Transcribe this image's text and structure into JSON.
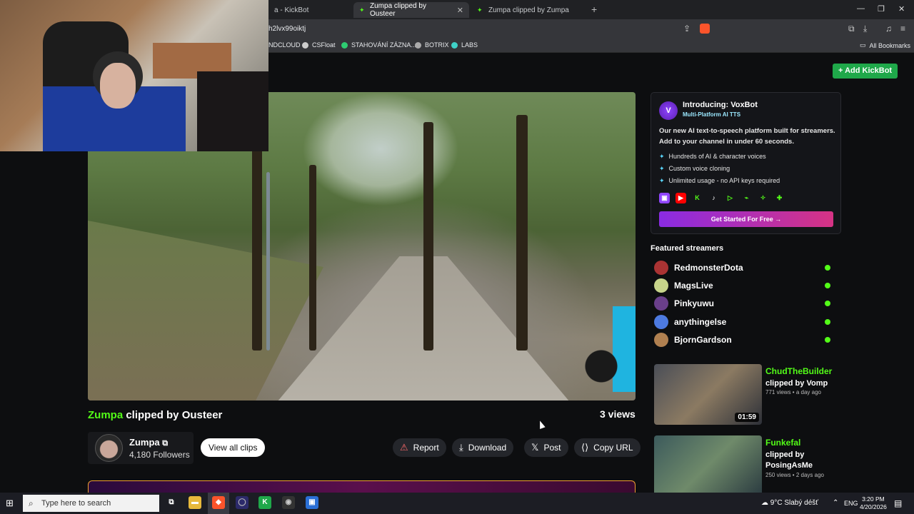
{
  "browser": {
    "tabs": [
      {
        "label": "a - KickBot",
        "active": false
      },
      {
        "label": "Zumpa clipped by Ousteer",
        "active": true
      },
      {
        "label": "Zumpa clipped by Zumpa",
        "active": false
      }
    ],
    "url": "h2lvx99oiktj",
    "bookmarks": [
      "NDCLOUD",
      "CSFloat",
      "STAHOVÁNÍ ZÁZNA...",
      "BOTRIX",
      "LABS"
    ],
    "all_bookmarks": "All Bookmarks"
  },
  "header": {
    "add_kickbot": "+ Add KickBot"
  },
  "clip": {
    "channel_name": "Zumpa",
    "title_rest": "clipped by Ousteer",
    "views": "3 views",
    "streamer": "Zumpa",
    "followers": "4,180 Followers",
    "view_all": "View all clips",
    "actions": {
      "report": "Report",
      "download": "Download",
      "post": "Post",
      "copy_url": "Copy URL"
    }
  },
  "promo": {
    "title": "Introducing: VoxBot",
    "subtitle": "Multi-Platform AI TTS",
    "description": "Our new AI text-to-speech platform built for streamers. Add to your channel in under 60 seconds.",
    "features": [
      "Hundreds of AI & character voices",
      "Custom voice cloning",
      "Unlimited usage - no API keys required"
    ],
    "cta": "Get Started For Free →"
  },
  "featured": {
    "title": "Featured streamers",
    "streamers": [
      "RedmonsterDota",
      "MagsLive",
      "Pinkyuwu",
      "anythingelse",
      "BjornGardson"
    ]
  },
  "related": [
    {
      "channel": "ChudTheBuilder",
      "by": "clipped by Vomp",
      "meta": "771 views • a day ago",
      "duration": "01:59"
    },
    {
      "channel": "Funkefal",
      "by": "clipped by PosingAsMe",
      "meta": "250 views • 2 days ago",
      "duration": ""
    }
  ],
  "taskbar": {
    "search_placeholder": "Type here to search",
    "weather": "9°C  Slabý déšť",
    "lang": "ENG",
    "time": "3:20 PM",
    "date": "4/20/2026"
  }
}
